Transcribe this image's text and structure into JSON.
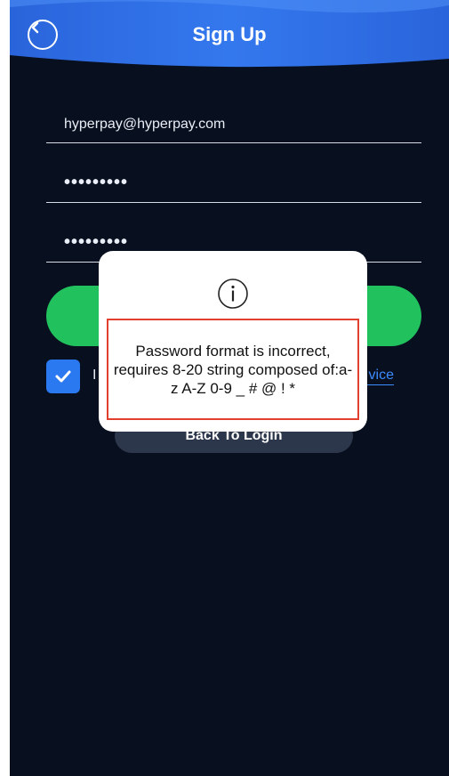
{
  "header": {
    "title": "Sign Up",
    "back_icon": "chevron-left-icon"
  },
  "form": {
    "email_value": "hyperpay@hyperpay.com",
    "password_value": "•••••••••",
    "confirm_password_value": "•••••••••"
  },
  "agreement": {
    "text": "I",
    "link_text": "vice",
    "checked": true
  },
  "back_to_login_label": "Back To Login",
  "modal": {
    "icon": "info-icon",
    "message": "Password format is incorrect, requires 8-20 string composed of:a-z A-Z 0-9 _ # @ ! *"
  },
  "colors": {
    "header_blue": "#2f6fe6",
    "background": "#080f1f",
    "primary_green": "#21c25e",
    "checkbox_blue": "#2b79f0",
    "link_blue": "#3d8cff",
    "highlight_red": "#e2402f"
  }
}
